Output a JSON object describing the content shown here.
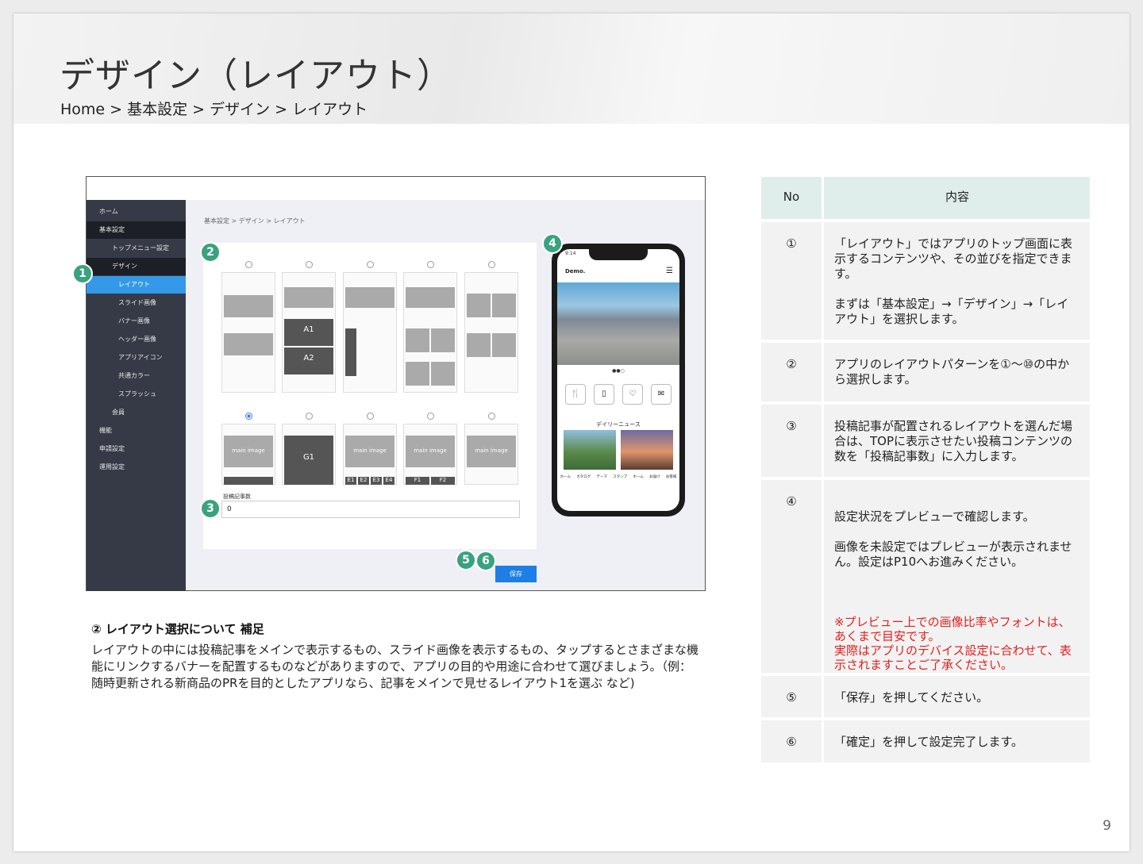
{
  "page": {
    "title": "デザイン（レイアウト）",
    "breadcrumb": "Home > 基本設定 > デザイン > レイアウト",
    "page_number": "9"
  },
  "screenshot": {
    "sidebar": [
      "ホーム",
      "基本設定",
      "トップメニュー設定",
      "デザイン",
      "レイアウト",
      "スライド画像",
      "バナー画像",
      "ヘッダー画像",
      "アプリアイコン",
      "共通カラー",
      "スプラッシュ",
      "会員",
      "機能",
      "申請設定",
      "運用設定"
    ],
    "breadcrumb": "基本設定 > デザイン > レイアウト",
    "thumb_labels": [
      "main image",
      "main image",
      "main image",
      "main image",
      "main image",
      "main image",
      "main image"
    ],
    "a1": "A1",
    "a2": "A2",
    "g1": "G1",
    "e_labels": [
      "E1",
      "E2",
      "E3",
      "E4"
    ],
    "f_labels": [
      "F1",
      "F2"
    ],
    "count_label": "投稿記事数",
    "count_value": "0",
    "save_label": "保存",
    "phone": {
      "brand": "Demo.",
      "time": "9:14",
      "section": "デイリーニュース",
      "tabs": [
        "ホーム",
        "カタログ",
        "テーマ",
        "スタンプ",
        "ホーム",
        "お届け",
        "お客様"
      ]
    },
    "badges": [
      "1",
      "2",
      "3",
      "4",
      "5",
      "6"
    ]
  },
  "notes": {
    "title": "② レイアウト選択について 補足",
    "body": "レイアウトの中には投稿記事をメインで表示するもの、スライド画像を表示するもの、タップするとさまざまな機能にリンクするバナーを配置するものなどがありますので、アプリの目的や用途に合わせて選びましょう。（例：随時更新される新商品のPRを目的としたアプリなら、記事をメインで見せるレイアウト1を選ぶ など)"
  },
  "table": {
    "headers": [
      "No",
      "内容"
    ],
    "rows": [
      {
        "no": "①",
        "text": "「レイアウト」ではアプリのトップ画面に表示するコンテンツや、その並びを指定できます。\n\nまずは「基本設定」→「デザイン」→「レイアウト」を選択します。"
      },
      {
        "no": "②",
        "text": "アプリのレイアウトパターンを①～⑩の中から選択します。"
      },
      {
        "no": "③",
        "text": "投稿記事が配置されるレイアウトを選んだ場合は、TOPに表示させたい投稿コンテンツの数を「投稿記事数」に入力します。"
      },
      {
        "no": "④",
        "text": "設定状況をプレビューで確認します。\n\n画像を未設定ではプレビューが表示されません。設定はP10へお進みください。",
        "warn": "※プレビュー上での画像比率やフォントは、あくまで目安です。\n実際はアプリのデバイス設定に合わせて、表示されますことご了承ください。"
      },
      {
        "no": "⑤",
        "text": "「保存」を押してください。"
      },
      {
        "no": "⑥",
        "text": "「確定」を押して設定完了します。"
      }
    ]
  },
  "colors": {
    "accent": "#3aa27e",
    "sidebar": "#363a47",
    "active": "#3499e8",
    "header_cell": "#dfeeeb",
    "warn": "#e02020"
  }
}
